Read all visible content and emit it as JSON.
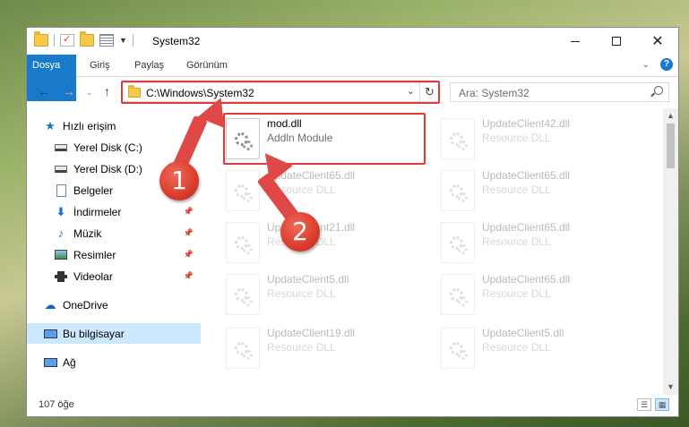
{
  "window": {
    "title": "System32"
  },
  "ribbon": {
    "tabs": [
      "Dosya",
      "Giriş",
      "Paylaş",
      "Görünüm"
    ]
  },
  "nav": {
    "address": "C:\\Windows\\System32",
    "search_placeholder": "Ara: System32"
  },
  "sidebar": {
    "items": [
      {
        "label": "Hızlı erişim",
        "icon": "star-icon"
      },
      {
        "label": "Yerel Disk (C:)",
        "icon": "drive-icon"
      },
      {
        "label": "Yerel Disk (D:)",
        "icon": "drive-icon"
      },
      {
        "label": "Belgeler",
        "icon": "documents-icon"
      },
      {
        "label": "İndirmeler",
        "icon": "downloads-icon"
      },
      {
        "label": "Müzik",
        "icon": "music-icon"
      },
      {
        "label": "Resimler",
        "icon": "pictures-icon"
      },
      {
        "label": "Videolar",
        "icon": "videos-icon"
      },
      {
        "label": "OneDrive",
        "icon": "cloud-icon"
      },
      {
        "label": "Bu bilgisayar",
        "icon": "computer-icon"
      },
      {
        "label": "Ağ",
        "icon": "network-icon"
      }
    ]
  },
  "files": [
    {
      "name": "mod.dll",
      "type": "Addln Module",
      "highlighted": true
    },
    {
      "name": "UpdateClient42.dll",
      "type": "Resource DLL"
    },
    {
      "name": "UpdateClient65.dll",
      "type": "Resource DLL"
    },
    {
      "name": "UpdateClient65.dll",
      "type": "Resource DLL"
    },
    {
      "name": "UpdateClient21.dll",
      "type": "Resource DLL"
    },
    {
      "name": "UpdateClient65.dll",
      "type": "Resource DLL"
    },
    {
      "name": "UpdateClient5.dll",
      "type": "Resource DLL"
    },
    {
      "name": "UpdateClient65.dll",
      "type": "Resource DLL"
    },
    {
      "name": "UpdateClient19.dll",
      "type": "Resource DLL"
    },
    {
      "name": "UpdateClient5.dll",
      "type": "Resource DLL"
    }
  ],
  "status": {
    "item_count": "107 öğe"
  },
  "annotations": {
    "step1": "1",
    "step2": "2",
    "highlight_color": "#e03b3b"
  }
}
